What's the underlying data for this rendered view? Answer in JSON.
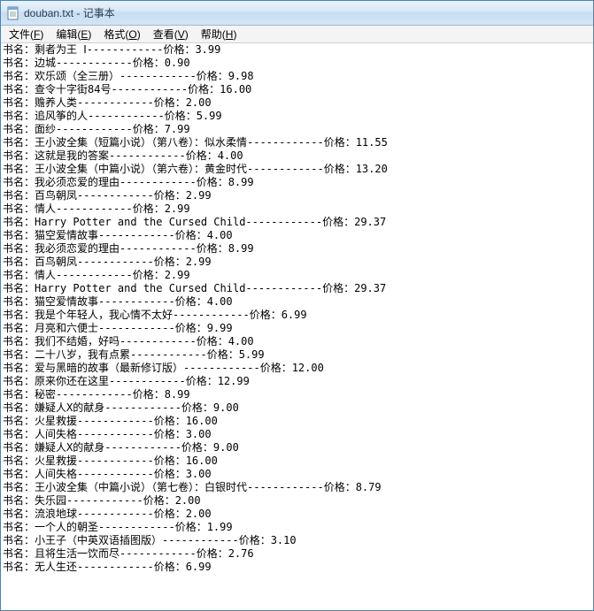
{
  "window": {
    "title": "douban.txt - 记事本",
    "ghost_tabs": [
      "",
      "",
      ""
    ]
  },
  "menu": {
    "file": {
      "label": "文件",
      "accel": "F"
    },
    "edit": {
      "label": "编辑",
      "accel": "E"
    },
    "format": {
      "label": "格式",
      "accel": "O"
    },
    "view": {
      "label": "查看",
      "accel": "V"
    },
    "help": {
      "label": "帮助",
      "accel": "H"
    }
  },
  "labels": {
    "book_prefix": "书名：",
    "price_prefix": "价格：",
    "sep_char": "-"
  },
  "lines": [
    {
      "title": "剩者为王 Ⅰ",
      "sep": 12,
      "price": "3.99"
    },
    {
      "title": "边城",
      "sep": 12,
      "price": "0.90"
    },
    {
      "title": "欢乐颂（全三册）",
      "sep": 12,
      "price": "9.98"
    },
    {
      "title": "查令十字街84号",
      "sep": 12,
      "price": "16.00"
    },
    {
      "title": "赡养人类",
      "sep": 12,
      "price": "2.00"
    },
    {
      "title": "追风筝的人",
      "sep": 12,
      "price": "5.99"
    },
    {
      "title": "面纱",
      "sep": 12,
      "price": "7.99"
    },
    {
      "title": "王小波全集（短篇小说）（第八卷）：似水柔情",
      "sep": 12,
      "price": "11.55"
    },
    {
      "title": "这就是我的答案",
      "sep": 12,
      "price": "4.00"
    },
    {
      "title": "王小波全集（中篇小说）（第六卷）：黄金时代",
      "sep": 12,
      "price": "13.20"
    },
    {
      "title": "我必须恋爱的理由",
      "sep": 12,
      "price": "8.99"
    },
    {
      "title": "百鸟朝凤",
      "sep": 12,
      "price": "2.99"
    },
    {
      "title": "情人",
      "sep": 12,
      "price": "2.99"
    },
    {
      "title": "Harry Potter and the Cursed Child",
      "sep": 12,
      "price": "29.37"
    },
    {
      "title": "猫空爱情故事",
      "sep": 12,
      "price": "4.00"
    },
    {
      "title": "我必须恋爱的理由",
      "sep": 12,
      "price": "8.99"
    },
    {
      "title": "百鸟朝凤",
      "sep": 12,
      "price": "2.99"
    },
    {
      "title": "情人",
      "sep": 12,
      "price": "2.99"
    },
    {
      "title": "Harry Potter and the Cursed Child",
      "sep": 12,
      "price": "29.37"
    },
    {
      "title": "猫空爱情故事",
      "sep": 12,
      "price": "4.00"
    },
    {
      "title": "我是个年轻人，我心情不太好",
      "sep": 12,
      "price": "6.99"
    },
    {
      "title": "月亮和六便士",
      "sep": 12,
      "price": "9.99"
    },
    {
      "title": "我们不结婚，好吗",
      "sep": 12,
      "price": "4.00"
    },
    {
      "title": "二十八岁，我有点累",
      "sep": 12,
      "price": "5.99"
    },
    {
      "title": "爱与黑暗的故事（最新修订版）",
      "sep": 12,
      "price": "12.00"
    },
    {
      "title": "原来你还在这里",
      "sep": 12,
      "price": "12.99"
    },
    {
      "title": "秘密",
      "sep": 12,
      "price": "8.99"
    },
    {
      "title": "嫌疑人X的献身",
      "sep": 12,
      "price": "9.00"
    },
    {
      "title": "火星救援",
      "sep": 12,
      "price": "16.00"
    },
    {
      "title": "人间失格",
      "sep": 12,
      "price": "3.00"
    },
    {
      "title": "嫌疑人X的献身",
      "sep": 12,
      "price": "9.00"
    },
    {
      "title": "火星救援",
      "sep": 12,
      "price": "16.00"
    },
    {
      "title": "人间失格",
      "sep": 12,
      "price": "3.00"
    },
    {
      "title": "王小波全集（中篇小说）（第七卷）：白银时代",
      "sep": 12,
      "price": "8.79"
    },
    {
      "title": "失乐园",
      "sep": 12,
      "price": "2.00"
    },
    {
      "title": "流浪地球",
      "sep": 12,
      "price": "2.00"
    },
    {
      "title": "一个人的朝圣",
      "sep": 12,
      "price": "1.99"
    },
    {
      "title": "小王子（中英双语插图版）",
      "sep": 12,
      "price": "3.10"
    },
    {
      "title": "且将生活一饮而尽",
      "sep": 12,
      "price": "2.76"
    },
    {
      "title": "无人生还",
      "sep": 12,
      "price": "6.99"
    }
  ]
}
